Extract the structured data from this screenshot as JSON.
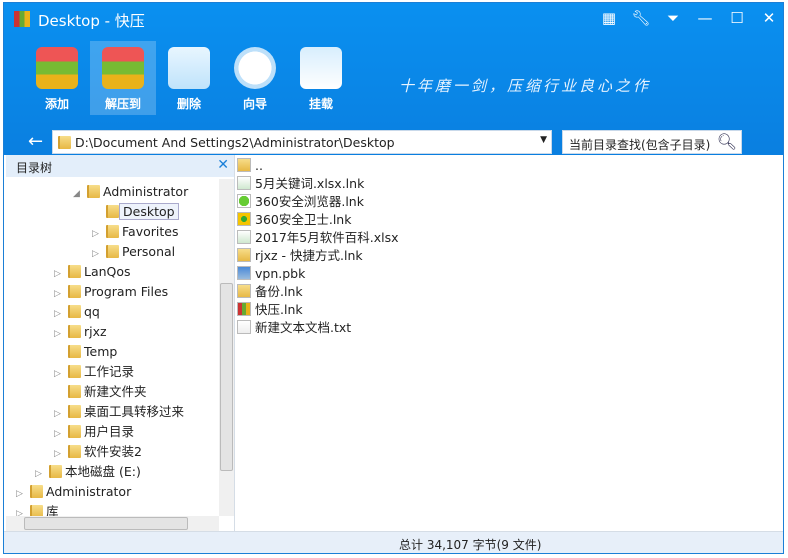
{
  "window": {
    "title": "Desktop - 快压"
  },
  "toolbar": [
    {
      "label": "添加",
      "icon": "add-archive-icon"
    },
    {
      "label": "解压到",
      "icon": "extract-icon"
    },
    {
      "label": "删除",
      "icon": "recycle-bin-icon"
    },
    {
      "label": "向导",
      "icon": "compass-icon"
    },
    {
      "label": "挂载",
      "icon": "drive-icon"
    }
  ],
  "slogan": "十年磨一剑，压缩行业良心之作",
  "address": {
    "path": "D:\\Document And Settings2\\Administrator\\Desktop"
  },
  "search": {
    "placeholder": "当前目录查找(包含子目录)"
  },
  "tree": {
    "title": "目录树",
    "items": [
      {
        "label": "Administrator",
        "level": 3,
        "arrow": "◢"
      },
      {
        "label": "Desktop",
        "level": 4,
        "arrow": "",
        "selected": true
      },
      {
        "label": "Favorites",
        "level": 4,
        "arrow": "▷"
      },
      {
        "label": "Personal",
        "level": 4,
        "arrow": "▷"
      },
      {
        "label": "LanQos",
        "level": 2,
        "arrow": "▷"
      },
      {
        "label": "Program Files",
        "level": 2,
        "arrow": "▷"
      },
      {
        "label": "qq",
        "level": 2,
        "arrow": "▷"
      },
      {
        "label": "rjxz",
        "level": 2,
        "arrow": "▷"
      },
      {
        "label": "Temp",
        "level": 2,
        "arrow": ""
      },
      {
        "label": "工作记录",
        "level": 2,
        "arrow": "▷"
      },
      {
        "label": "新建文件夹",
        "level": 2,
        "arrow": ""
      },
      {
        "label": "桌面工具转移过来",
        "level": 2,
        "arrow": "▷"
      },
      {
        "label": "用户目录",
        "level": 2,
        "arrow": "▷"
      },
      {
        "label": "软件安装2",
        "level": 2,
        "arrow": "▷"
      },
      {
        "label": "本地磁盘 (E:)",
        "level": 1,
        "arrow": "▷"
      },
      {
        "label": "Administrator",
        "level": 0,
        "arrow": "▷"
      },
      {
        "label": "库",
        "level": 0,
        "arrow": "▷"
      }
    ]
  },
  "files": [
    {
      "name": "..",
      "icon": "folder"
    },
    {
      "name": "5月关键词.xlsx.lnk",
      "icon": "excel"
    },
    {
      "name": "360安全浏览器.lnk",
      "icon": "browser"
    },
    {
      "name": "360安全卫士.lnk",
      "icon": "guard"
    },
    {
      "name": "2017年5月软件百科.xlsx",
      "icon": "excel"
    },
    {
      "name": "rjxz - 快捷方式.lnk",
      "icon": "folder"
    },
    {
      "name": "vpn.pbk",
      "icon": "network"
    },
    {
      "name": "备份.lnk",
      "icon": "folder"
    },
    {
      "name": "快压.lnk",
      "icon": "kuaiya"
    },
    {
      "name": "新建文本文档.txt",
      "icon": "text"
    }
  ],
  "status": {
    "summary": "总计  34,107 字节(9 文件)"
  },
  "colors": {
    "accent": "#0a88ec"
  }
}
